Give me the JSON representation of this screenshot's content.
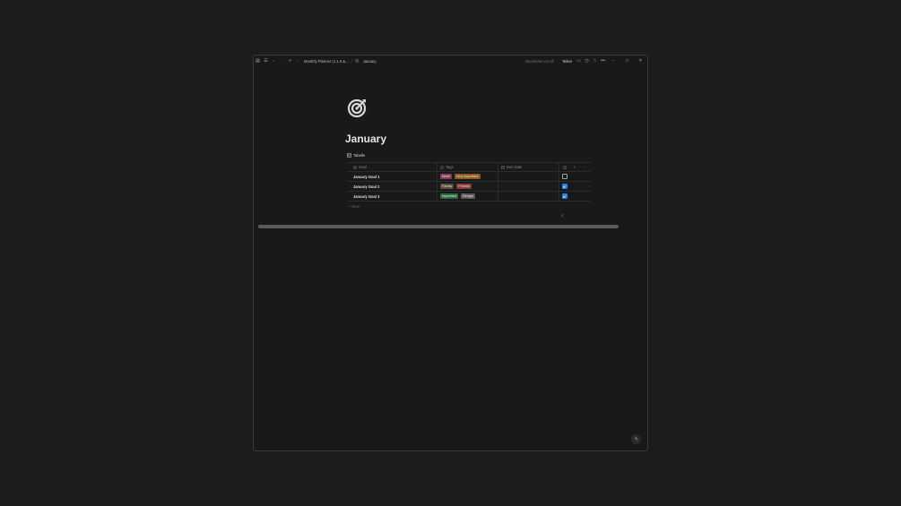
{
  "titlebar": {
    "breadcrumb_parent": "Monthly Planner (1.1.0 &...",
    "breadcrumb_current": "January",
    "edited": "Bearbeitet vor 8h",
    "share_label": "Teilen"
  },
  "page": {
    "title": "January",
    "view_label": "Tabelle"
  },
  "table": {
    "headers": {
      "goal": "Goal",
      "tags": "Tags",
      "due": "Due Date"
    },
    "rows": [
      {
        "goal": "January Goal 1",
        "tags": [
          {
            "label": "Work",
            "color": "#8a3a5c"
          },
          {
            "label": "Very Important",
            "color": "#8a5a1c"
          }
        ],
        "done": false
      },
      {
        "goal": "January Goal 2",
        "tags": [
          {
            "label": "Family",
            "color": "#5a4a3a"
          },
          {
            "label": "Friends",
            "color": "#8a3a3a"
          }
        ],
        "done": true
      },
      {
        "goal": "January Goal 3",
        "tags": [
          {
            "label": "Important",
            "color": "#2e6a44"
          },
          {
            "label": "Design",
            "color": "#5a5a5a"
          }
        ],
        "done": true
      }
    ],
    "new_label": "+ New",
    "count": "2"
  },
  "colors": {
    "accent": "#2383e2",
    "background": "#191919"
  }
}
